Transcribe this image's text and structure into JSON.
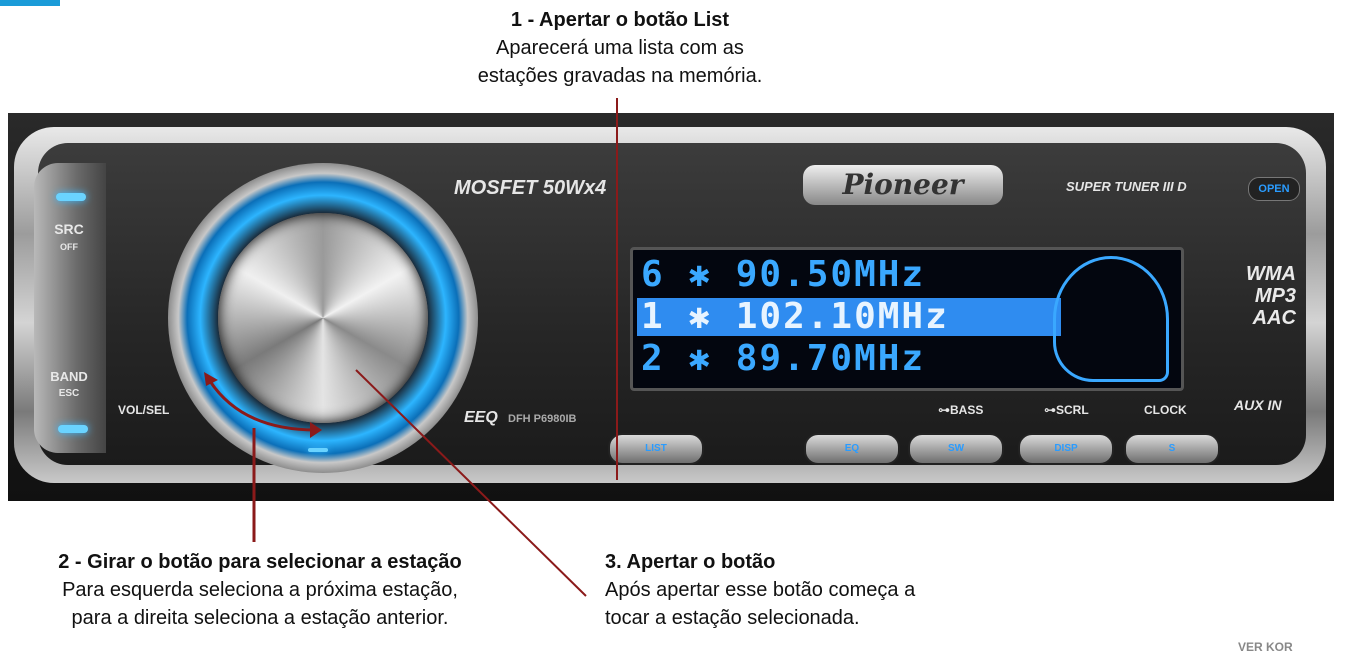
{
  "captions": {
    "list": {
      "title": "1 - Apertar o botão List",
      "line1": "Aparecerá uma  lista com as",
      "line2": "estações gravadas na memória."
    },
    "knob": {
      "title": "2 - Girar o botão para selecionar a estação",
      "line1": "Para esquerda  seleciona a próxima estação,",
      "line2": "para a direita seleciona a estação anterior."
    },
    "press": {
      "title": "3. Apertar o botão",
      "line1": "Após apertar esse botão começa a",
      "line2": "tocar a estação selecionada."
    }
  },
  "device": {
    "brand": "Pioneer",
    "power_label": "MOSFET 50Wx4",
    "tuner_label": "SUPER TUNER III D",
    "open_label": "OPEN",
    "src_label": "SRC",
    "off_label": "OFF",
    "band_label": "BAND",
    "esc_label": "ESC",
    "vol_label": "VOL/SEL",
    "eeq_label": "EEQ",
    "model_label": "DFH P6980IB",
    "bass_label": "BASS",
    "scrl_label": "SCRL",
    "clock_label": "CLOCK",
    "auxin_label": "AUX IN",
    "formats": [
      "WMA",
      "MP3",
      "AAC"
    ],
    "buttons": [
      "LIST",
      "EQ",
      "SW",
      "DISP",
      "S"
    ]
  },
  "display": {
    "rows": [
      {
        "preset": "6",
        "freq": "90.50MHz",
        "selected": false
      },
      {
        "preset": "1",
        "freq": "102.10MHz",
        "selected": true
      },
      {
        "preset": "2",
        "freq": "89.70MHz",
        "selected": false
      }
    ]
  },
  "colors": {
    "accent_blue": "#2a9cff",
    "arrow_red": "#8b1a1a"
  },
  "watermark": "VER KOR"
}
